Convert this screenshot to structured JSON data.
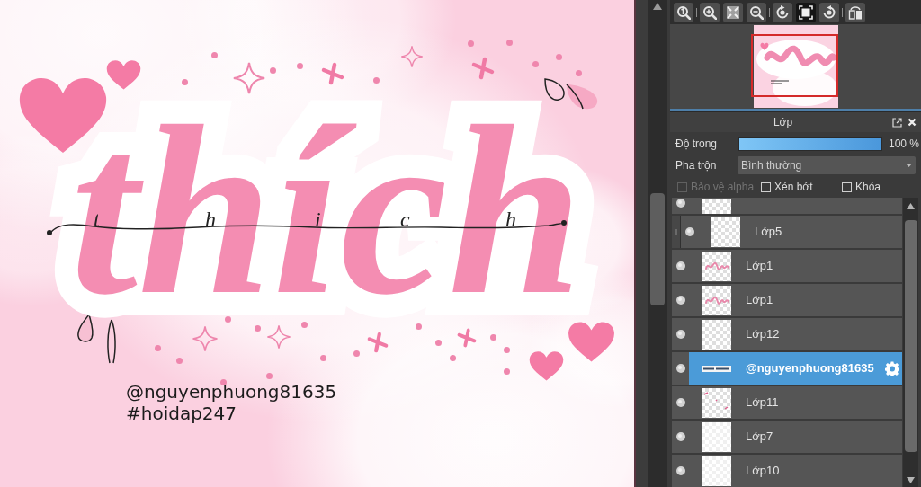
{
  "canvas": {
    "lettering": "thích",
    "script_letters": [
      "t",
      "h",
      "i",
      "c",
      "h"
    ],
    "signature": "@nguyenphuong81635",
    "hashtag": "#hoidap247"
  },
  "toolbar_groups": [
    [
      {
        "kind": "zoom-actual",
        "selected": false
      }
    ],
    [
      {
        "kind": "zoom-in",
        "selected": false
      },
      {
        "kind": "fit",
        "selected": false
      },
      {
        "kind": "zoom-out",
        "selected": false
      }
    ],
    [
      {
        "kind": "rotate-left",
        "selected": false
      },
      {
        "kind": "frame",
        "selected": true
      },
      {
        "kind": "rotate-right",
        "selected": false
      }
    ],
    [
      {
        "kind": "flip",
        "selected": false
      }
    ]
  ],
  "layer_panel": {
    "title": "Lớp",
    "opacity": {
      "label": "Độ trong",
      "level": 1,
      "reading": "100 %"
    },
    "blend": {
      "label": "Pha trộn",
      "value": "Bình thường"
    },
    "options": [
      {
        "label": "Bảo vệ alpha",
        "checked": false,
        "disabled": true
      },
      {
        "label": "Xén bớt",
        "checked": false,
        "disabled": false
      },
      {
        "label": "Khóa",
        "checked": false,
        "disabled": false
      }
    ],
    "layers": [
      {
        "kind": "checker",
        "visible": true,
        "clipped": false,
        "selected": false
      },
      {
        "name": "Lớp5",
        "kind": "checker",
        "visible": true,
        "clipped": true,
        "selected": false
      },
      {
        "name": "Lớp1",
        "kind": "lettering",
        "visible": true,
        "clipped": false,
        "selected": false
      },
      {
        "name": "Lớp1",
        "kind": "lettering",
        "visible": true,
        "clipped": false,
        "selected": false
      },
      {
        "name": "Lớp12",
        "kind": "checker",
        "visible": true,
        "clipped": false,
        "selected": false
      },
      {
        "name": "@nguyenphuong81635",
        "kind": "signature",
        "visible": true,
        "clipped": false,
        "selected": true
      },
      {
        "name": "Lớp11",
        "kind": "marks",
        "visible": true,
        "clipped": false,
        "selected": false
      },
      {
        "name": "Lớp7",
        "kind": "white",
        "visible": true,
        "clipped": false,
        "selected": false
      },
      {
        "name": "Lớp10",
        "kind": "white",
        "visible": true,
        "clipped": false,
        "selected": false
      }
    ]
  }
}
